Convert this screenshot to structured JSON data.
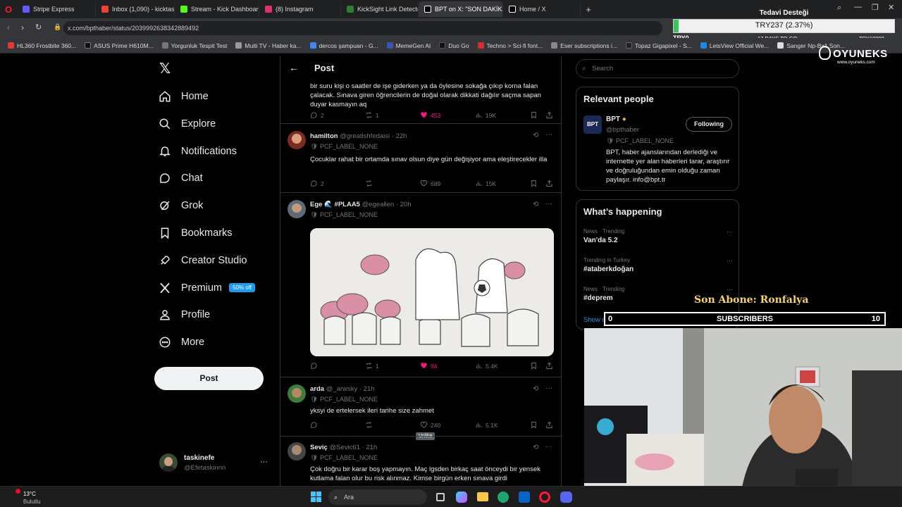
{
  "browser": {
    "tabs": [
      {
        "label": "Stripe Express",
        "color": "#635bff"
      },
      {
        "label": "Inbox (1,090) - kicktaskinefe",
        "color": "#ea4335"
      },
      {
        "label": "Stream - Kick Dashboard",
        "color": "#53fc18"
      },
      {
        "label": "(8) Instagram",
        "color": "#e1306c"
      },
      {
        "label": "KickSight Link Detector",
        "color": "#2e7d32"
      },
      {
        "label": "BPT on X: \"SON DAKİKA: ...",
        "color": "#ffffff"
      },
      {
        "label": "Home / X",
        "color": "#ffffff"
      }
    ],
    "url": "x.com/bpthaber/status/2039992638342889492",
    "bookmarks": [
      "HL360 Frostbite 360...",
      "ASUS Prime H610M...",
      "Yorgunluk Tespit Test",
      "Multi TV - Haber ka...",
      "dercos şampuan - G...",
      "MemeGen AI",
      "Duo Go",
      "Techno > Sci-fi font...",
      "Eser subscriptions i...",
      "Topaz Gigapixel - S...",
      "LetsView Official We...",
      "Sanger Np-Bx1 Son...",
      "Sanger Np-BX1 Son..."
    ]
  },
  "donation": {
    "title": "Tedavi Desteği",
    "amount": "TRY237 (2.37%)",
    "min": "TRY0",
    "days": "17 DAYS TO GO",
    "max": "TRY10000",
    "progress": 0.0237
  },
  "brand": {
    "name": "OYUNEKS",
    "site": "www.oyuneks.com"
  },
  "nav": {
    "items": [
      {
        "label": "Home",
        "icon": "home-icon"
      },
      {
        "label": "Explore",
        "icon": "search-icon"
      },
      {
        "label": "Notifications",
        "icon": "bell-icon"
      },
      {
        "label": "Chat",
        "icon": "chat-icon"
      },
      {
        "label": "Grok",
        "icon": "grok-icon"
      },
      {
        "label": "Bookmarks",
        "icon": "bookmark-icon"
      },
      {
        "label": "Creator Studio",
        "icon": "rocket-icon"
      },
      {
        "label": "Premium",
        "icon": "x-logo-icon"
      },
      {
        "label": "Profile",
        "icon": "person-icon"
      },
      {
        "label": "More",
        "icon": "more-circle-icon"
      }
    ],
    "premium_badge": "50% off",
    "post_button": "Post",
    "account": {
      "name": "taskinefe",
      "handle": "@Efetaskinnn"
    }
  },
  "header": {
    "title": "Post"
  },
  "tweets": [
    {
      "text": "bir suru kişi o saatler de işe giderken ya da öylesine sokağa çıkıp korna falan çalacak. Sınava giren öğrencilerin de doğal olarak dikkati dağılır saçma sapan duyar kasmayın aq",
      "replies": "2",
      "reposts": "1",
      "likes": "453",
      "views": "19K"
    },
    {
      "name": "hamilton",
      "handle": "@greatishfedaisi",
      "time": "22h",
      "label": "PCF_LABEL_NONE",
      "text": "Çocuklar rahat bir ortamda sınav olsun diye gün değişiyor ama eleştirecekler illa",
      "replies": "2",
      "reposts": "",
      "likes": "689",
      "views": "15K"
    },
    {
      "name": "Ege 🌊 #PLAA5",
      "handle": "@egeallen",
      "time": "20h",
      "label": "PCF_LABEL_NONE",
      "text": "",
      "replies": "",
      "reposts": "1",
      "likes": "94",
      "views": "5.4K",
      "tooltip": "Unlike"
    },
    {
      "name": "arda",
      "handle": "@_arwsky",
      "time": "21h",
      "label": "PCF_LABEL_NONE",
      "text": "yksyi de ertelersek ileri tarihe size zahmet",
      "replies": "",
      "reposts": "",
      "likes": "240",
      "views": "5.1K"
    },
    {
      "name": "Seviç",
      "handle": "@Sevic61",
      "time": "21h",
      "label": "PCF_LABEL_NONE",
      "text": "Çok doğru bir karar boş yapmayın. Maç lgsden birkaç saat önceydi bir yensek kutlama falan olur bu risk alınmaz. Kimse birgün erken sınava girdi"
    }
  ],
  "right": {
    "search_placeholder": "Search",
    "relevant_title": "Relevant people",
    "person": {
      "name": "BPT",
      "handle": "@bpthaber",
      "label": "PCF_LABEL_NONE",
      "follow_button": "Following",
      "bio": "BPT, haber ajanslarından derlediği ve internette yer alan haberleri tarar, araştırır ve doğruluğundan emin olduğu zaman paylaşır. info@bpt.tr"
    },
    "happening_title": "What’s happening",
    "trends": [
      {
        "context": "News · Trending",
        "topic": "Van'da 5.2"
      },
      {
        "context": "Trending in Turkey",
        "topic": "#ataberkdoğan"
      },
      {
        "context": "News · Trending",
        "topic": "#deprem"
      }
    ],
    "show_more": "Show more"
  },
  "stream_overlay": {
    "latest_sub": "Son Abone: Ronfalya",
    "sub_label": "SUBSCRIBERS",
    "sub_current": "0",
    "sub_goal": "10"
  },
  "taskbar": {
    "weather_temp": "13°C",
    "weather_desc": "Bulutlu",
    "search_placeholder": "Ara"
  },
  "colors": {
    "like": "#f91880",
    "premium_badge": "#1d9bf0",
    "verified": "#e2b719"
  }
}
